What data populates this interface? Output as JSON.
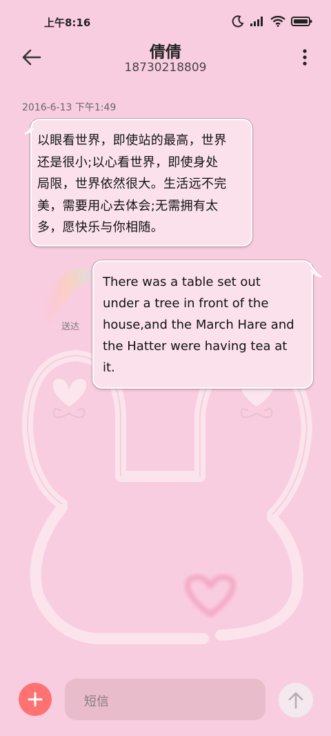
{
  "status_bar": {
    "time": "上午8:16",
    "icons": [
      "moon-icon",
      "signal-icon",
      "wifi-icon",
      "battery-icon"
    ]
  },
  "header": {
    "contact_name": "倩倩",
    "contact_number": "18730218809",
    "back_icon": "back-arrow-icon",
    "more_icon": "more-vertical-icon"
  },
  "conversation": {
    "timestamp": "2016-6-13 下午1:49",
    "messages": [
      {
        "direction": "incoming",
        "lines": [
          "以眼看世界，即使站的最高，世界",
          "还是很小;以心看世界，即使身处",
          "局限，世界依然很大。生活远不完",
          "美，需要用心去体会;无需拥有太",
          "多，愿快乐与你相随。"
        ]
      },
      {
        "direction": "outgoing",
        "lines": [
          "There was a table set out",
          "under a tree in front of the",
          "house,and the March Hare and",
          "the Hatter were having tea at",
          "it."
        ],
        "status": "送达"
      }
    ]
  },
  "composer": {
    "add_icon": "plus-icon",
    "placeholder": "短信",
    "send_icon": "send-arrow-icon"
  },
  "colors": {
    "background": "#f9cde0",
    "bubble": "#fbe1ec",
    "add_button": "#ff7272",
    "input": "#e8bccb"
  }
}
